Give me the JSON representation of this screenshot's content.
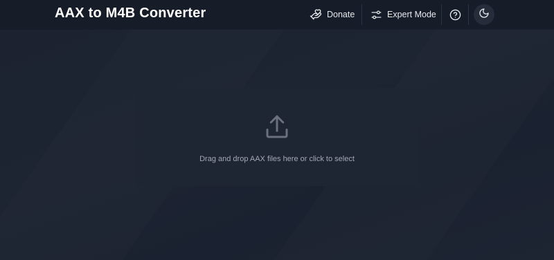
{
  "header": {
    "title": "AAX to M4B Converter",
    "donate_label": "Donate",
    "expert_label": "Expert Mode"
  },
  "icons": {
    "donate": "donate-hand-heart-icon",
    "expert": "sliders-icon",
    "help": "help-circle-icon",
    "theme": "moon-icon",
    "upload": "upload-icon"
  },
  "dropzone": {
    "text": "Drag and drop AAX files here or click to select"
  },
  "colors": {
    "background": "#1b2230",
    "header": "#161c28",
    "dropzone": "#1e2533",
    "text_primary": "#ffffff",
    "text_muted": "#a3a9b4",
    "icon_muted": "#6b717d"
  }
}
